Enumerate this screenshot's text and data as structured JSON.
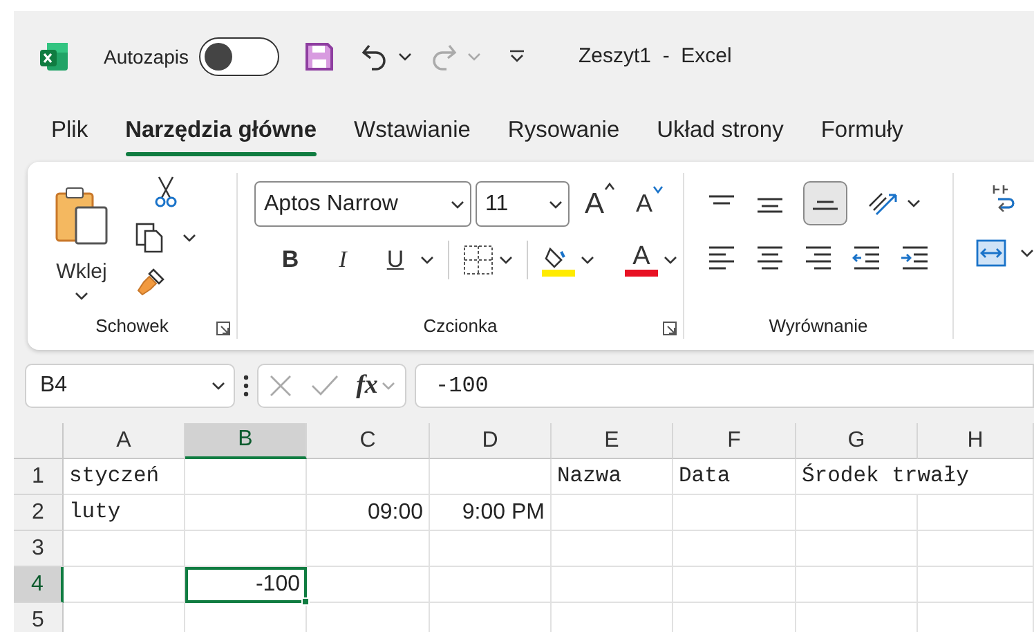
{
  "title_bar": {
    "autosave_label": "Autozapis",
    "autosave_on": false,
    "document_title": "Zeszyt1  -  Excel"
  },
  "tabs": [
    {
      "label": "Plik",
      "selected": false
    },
    {
      "label": "Narzędzia główne",
      "selected": true
    },
    {
      "label": "Wstawianie",
      "selected": false
    },
    {
      "label": "Rysowanie",
      "selected": false
    },
    {
      "label": "Układ strony",
      "selected": false
    },
    {
      "label": "Formuły",
      "selected": false
    }
  ],
  "ribbon": {
    "paste_label": "Wklej",
    "font_name": "Aptos Narrow",
    "font_size": "11",
    "grow_font": "A",
    "shrink_font": "A",
    "bold": "B",
    "italic": "I",
    "underline": "U",
    "font_color": "A",
    "groups": [
      {
        "label": "Schowek"
      },
      {
        "label": "Czcionka"
      },
      {
        "label": "Wyrównanie"
      }
    ]
  },
  "formula_bar": {
    "name_box": "B4",
    "function_label": "fx",
    "value": "-100"
  },
  "sheet": {
    "columns": [
      "A",
      "B",
      "C",
      "D",
      "E",
      "F",
      "G",
      "H"
    ],
    "rows": [
      {
        "header": "1",
        "cells": [
          {
            "text": "styczeń",
            "kind": "text",
            "selected": false
          },
          {
            "selected": false
          },
          {
            "selected": false
          },
          {
            "selected": false
          },
          {
            "text": "Nazwa",
            "kind": "text",
            "selected": false
          },
          {
            "text": "Data",
            "kind": "text",
            "selected": false
          },
          {
            "text": "Środek trwały",
            "kind": "text",
            "selected": false
          }
        ]
      },
      {
        "header": "2",
        "cells": [
          {
            "text": "luty",
            "kind": "text",
            "selected": false
          },
          {
            "selected": false
          },
          {
            "text": "09:00",
            "kind": "number",
            "selected": false
          },
          {
            "text": "9:00 PM",
            "kind": "number",
            "selected": false
          },
          {
            "selected": false
          },
          {
            "selected": false
          },
          {
            "selected": false
          },
          {
            "selected": false
          }
        ]
      },
      {
        "header": "3",
        "cells": [
          {
            "selected": false
          },
          {
            "selected": false
          },
          {
            "selected": false
          },
          {
            "selected": false
          },
          {
            "selected": false
          },
          {
            "selected": false
          },
          {
            "selected": false
          },
          {
            "selected": false
          }
        ]
      },
      {
        "header": "4",
        "cells": [
          {
            "selected": false
          },
          {
            "text": "-100",
            "kind": "number",
            "selected": true
          },
          {
            "selected": false
          },
          {
            "selected": false
          },
          {
            "selected": false
          },
          {
            "selected": false
          },
          {
            "selected": false
          },
          {
            "selected": false
          }
        ]
      },
      {
        "header": "5",
        "cells": [
          {
            "selected": false
          },
          {
            "selected": false
          },
          {
            "selected": false
          },
          {
            "selected": false
          },
          {
            "selected": false
          },
          {
            "selected": false
          },
          {
            "selected": false
          },
          {
            "selected": false
          }
        ]
      }
    ]
  }
}
